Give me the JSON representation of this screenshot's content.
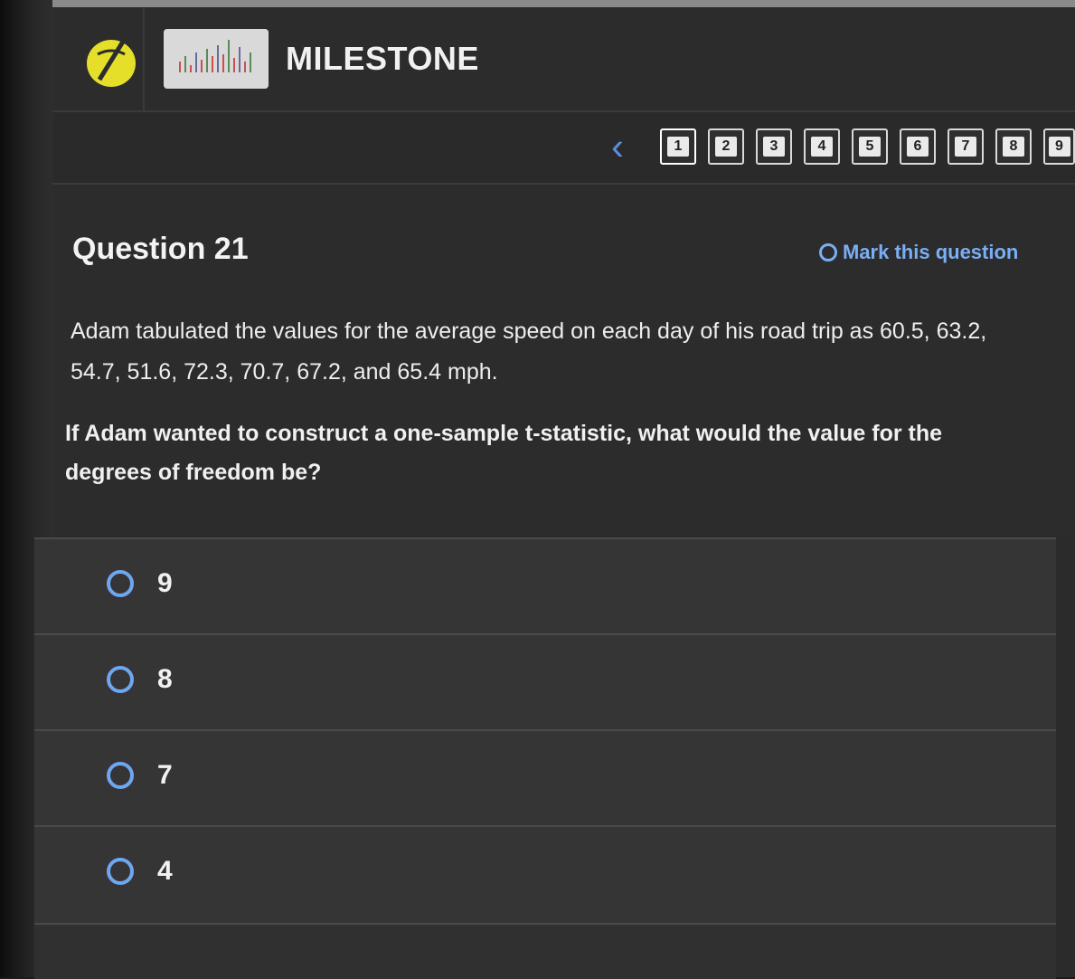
{
  "header": {
    "title": "MILESTONE"
  },
  "pager": {
    "pages": [
      "1",
      "2",
      "3",
      "4",
      "5",
      "6",
      "7",
      "8",
      "9"
    ],
    "current_page": "1"
  },
  "question": {
    "title": "Question 21",
    "mark_label": "Mark this question",
    "stem": "Adam tabulated the values for the average speed on each day of his road trip as 60.5, 63.2, 54.7, 51.6, 72.3, 70.7, 67.2, and 65.4 mph.",
    "prompt": "If Adam wanted to construct a one-sample t-statistic, what would the value for the degrees of freedom be?"
  },
  "choices": [
    {
      "label": "9"
    },
    {
      "label": "8"
    },
    {
      "label": "7"
    },
    {
      "label": "4"
    }
  ],
  "colors": {
    "accent": "#7aaef5",
    "logo": "#e6df2a",
    "background": "#2c2c2c"
  }
}
